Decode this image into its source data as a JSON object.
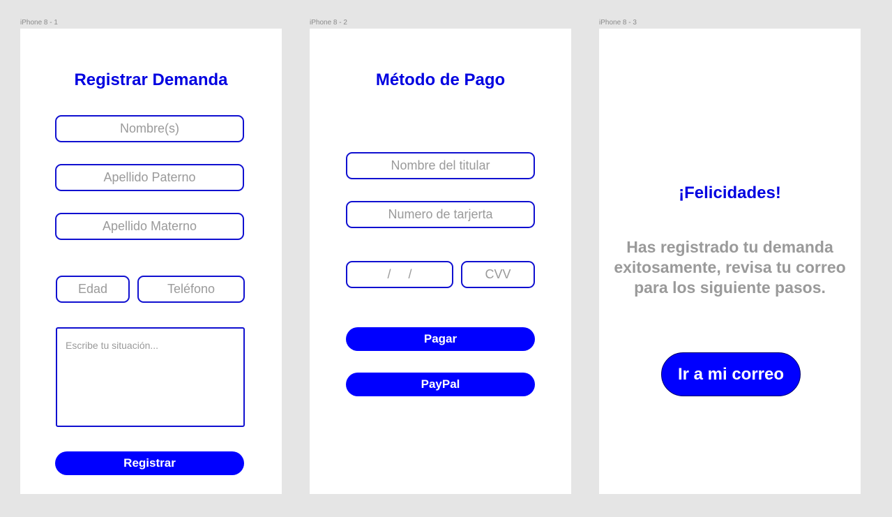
{
  "frames": [
    {
      "label": "iPhone 8 - 1",
      "title": "Registrar Demanda",
      "fields": {
        "nombre": "Nombre(s)",
        "apellido_paterno": "Apellido Paterno",
        "apellido_materno": "Apellido Materno",
        "edad": "Edad",
        "telefono": "Teléfono",
        "situacion": "Escribe tu situación..."
      },
      "button": "Registrar"
    },
    {
      "label": "iPhone 8 - 2",
      "title": "Método de Pago",
      "fields": {
        "titular": "Nombre del titular",
        "tarjeta": "Numero de tarjerta",
        "fecha": "/     /",
        "cvv": "CVV"
      },
      "buttons": {
        "pagar": "Pagar",
        "paypal": "PayPal"
      }
    },
    {
      "label": "iPhone 8 - 3",
      "title": "¡Felicidades!",
      "message": "Has registrado tu demanda exitosamente, revisa tu correo para los siguiente pasos.",
      "button": "Ir a mi correo"
    }
  ],
  "colors": {
    "accent": "#0000ff",
    "title": "#0000e0",
    "border": "#1010d0",
    "placeholder": "#9a9a9a",
    "canvas": "#e5e5e5"
  }
}
